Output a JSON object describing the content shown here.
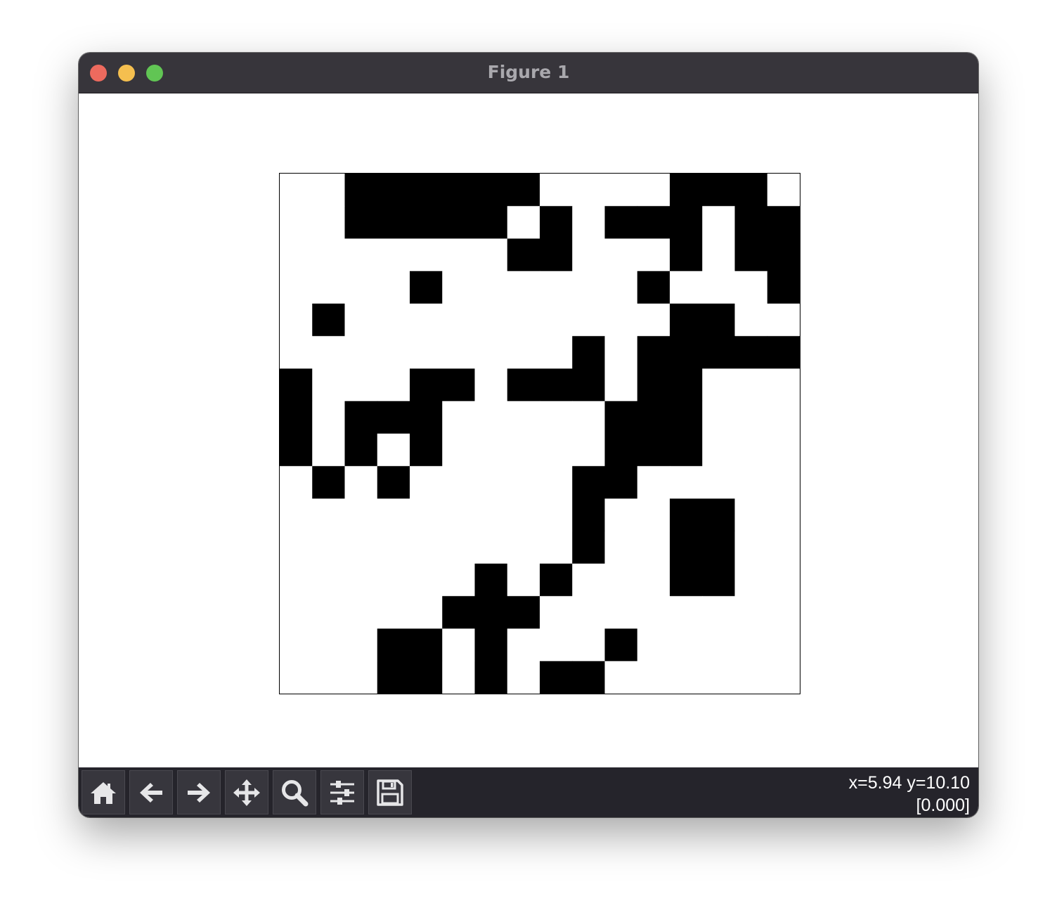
{
  "window": {
    "title": "Figure 1"
  },
  "toolbar": {
    "buttons": [
      {
        "name": "home-button",
        "icon": "home-icon"
      },
      {
        "name": "back-button",
        "icon": "arrow-left-icon"
      },
      {
        "name": "forward-button",
        "icon": "arrow-right-icon"
      },
      {
        "name": "pan-button",
        "icon": "move-icon"
      },
      {
        "name": "zoom-button",
        "icon": "magnifier-icon"
      },
      {
        "name": "configure-subplots-button",
        "icon": "sliders-icon"
      },
      {
        "name": "save-button",
        "icon": "floppy-disk-icon"
      }
    ],
    "coords_line1": "x=5.94 y=10.10",
    "coords_line2": "[0.000]"
  },
  "chart_data": {
    "type": "heatmap",
    "colormap": "binary",
    "title": "",
    "xlabel": "",
    "ylabel": "",
    "xlim": [
      -0.5,
      15.5
    ],
    "ylim": [
      15.5,
      -0.5
    ],
    "axes_visible": false,
    "colors": {
      "0": "#ffffff",
      "1": "#000000"
    },
    "rows": [
      [
        0,
        0,
        1,
        1,
        1,
        1,
        1,
        1,
        0,
        0,
        0,
        0,
        1,
        1,
        1,
        0
      ],
      [
        0,
        0,
        1,
        1,
        1,
        1,
        1,
        0,
        1,
        0,
        1,
        1,
        1,
        0,
        1,
        1
      ],
      [
        0,
        0,
        0,
        0,
        0,
        0,
        0,
        1,
        1,
        0,
        0,
        0,
        1,
        0,
        1,
        1
      ],
      [
        0,
        0,
        0,
        0,
        1,
        0,
        0,
        0,
        0,
        0,
        0,
        1,
        0,
        0,
        0,
        1
      ],
      [
        0,
        1,
        0,
        0,
        0,
        0,
        0,
        0,
        0,
        0,
        0,
        0,
        1,
        1,
        0,
        0
      ],
      [
        0,
        0,
        0,
        0,
        0,
        0,
        0,
        0,
        0,
        1,
        0,
        1,
        1,
        1,
        1,
        1
      ],
      [
        1,
        0,
        0,
        0,
        1,
        1,
        0,
        1,
        1,
        1,
        0,
        1,
        1,
        0,
        0,
        0
      ],
      [
        1,
        0,
        1,
        1,
        1,
        0,
        0,
        0,
        0,
        0,
        1,
        1,
        1,
        0,
        0,
        0
      ],
      [
        1,
        0,
        1,
        0,
        1,
        0,
        0,
        0,
        0,
        0,
        1,
        1,
        1,
        0,
        0,
        0
      ],
      [
        0,
        1,
        0,
        1,
        0,
        0,
        0,
        0,
        0,
        1,
        1,
        0,
        0,
        0,
        0,
        0
      ],
      [
        0,
        0,
        0,
        0,
        0,
        0,
        0,
        0,
        0,
        1,
        0,
        0,
        1,
        1,
        0,
        0
      ],
      [
        0,
        0,
        0,
        0,
        0,
        0,
        0,
        0,
        0,
        1,
        0,
        0,
        1,
        1,
        0,
        0
      ],
      [
        0,
        0,
        0,
        0,
        0,
        0,
        1,
        0,
        1,
        0,
        0,
        0,
        1,
        1,
        0,
        0
      ],
      [
        0,
        0,
        0,
        0,
        0,
        1,
        1,
        1,
        0,
        0,
        0,
        0,
        0,
        0,
        0,
        0
      ],
      [
        0,
        0,
        0,
        1,
        1,
        0,
        1,
        0,
        0,
        0,
        1,
        0,
        0,
        0,
        0,
        0
      ],
      [
        0,
        0,
        0,
        1,
        1,
        0,
        1,
        0,
        1,
        1,
        0,
        0,
        0,
        0,
        0,
        0
      ]
    ]
  }
}
